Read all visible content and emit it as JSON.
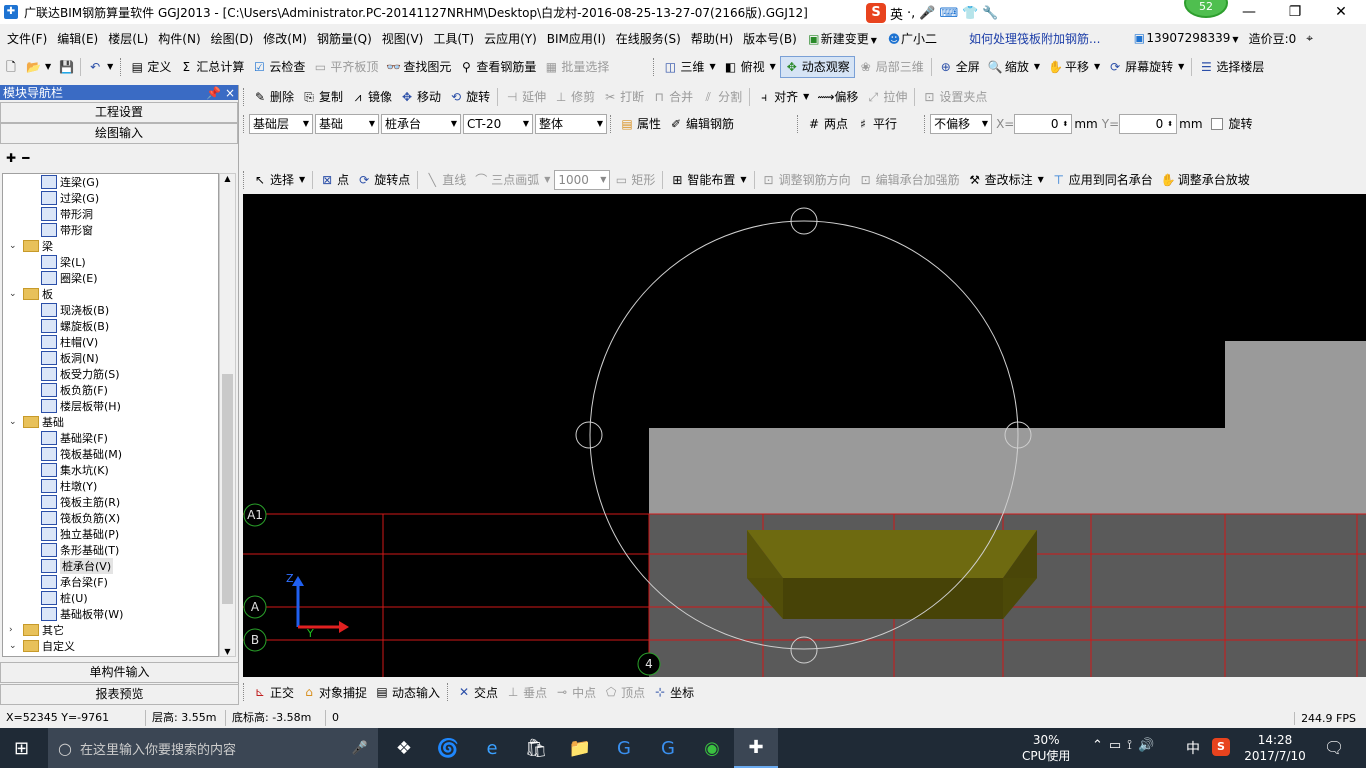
{
  "title": "广联达BIM钢筋算量软件 GGJ2013 - [C:\\Users\\Administrator.PC-20141127NRHM\\Desktop\\白龙村-2016-08-25-13-27-07(2166版).GGJ12]",
  "ime": {
    "mode": "英",
    "badge": "52"
  },
  "menu": [
    "文件(F)",
    "编辑(E)",
    "楼层(L)",
    "构件(N)",
    "绘图(D)",
    "修改(M)",
    "钢筋量(Q)",
    "视图(V)",
    "工具(T)",
    "云应用(Y)",
    "BIM应用(I)",
    "在线服务(S)",
    "帮助(H)",
    "版本号(B)",
    "新建变更",
    "广小二",
    "如何处理筏板附加钢筋...",
    "13907298339",
    "造价豆:0"
  ],
  "toolbar1": {
    "define": "定义",
    "sum": "汇总计算",
    "cloudcheck": "云检查",
    "flat": "平齐板顶",
    "find": "查找图元",
    "viewbar": "查看钢筋量",
    "batch": "批量选择",
    "three": "三维",
    "top": "俯视",
    "dynamic": "动态观察",
    "local3d": "局部三维",
    "full": "全屏",
    "zoom": "缩放",
    "pan": "平移",
    "rotate": "屏幕旋转",
    "floor": "选择楼层"
  },
  "toolbar2": {
    "delete": "删除",
    "copy": "复制",
    "mirror": "镜像",
    "move": "移动",
    "rotate": "旋转",
    "extend": "延伸",
    "trim": "修剪",
    "break": "打断",
    "merge": "合并",
    "split": "分割",
    "align": "对齐",
    "offset": "偏移",
    "stretch": "拉伸",
    "grip": "设置夹点"
  },
  "toolbar3": {
    "layer": "基础层",
    "cat": "基础",
    "type": "桩承台",
    "name": "CT-20",
    "whole": "整体",
    "prop": "属性",
    "editbar": "编辑钢筋",
    "twopt": "两点",
    "parallel": "平行",
    "offset": "不偏移",
    "xlabel": "X=",
    "xval": "0",
    "ylabel": "Y=",
    "yval": "0",
    "unit": "mm",
    "rot": "旋转"
  },
  "toolbar4": {
    "select": "选择",
    "point": "点",
    "rotpt": "旋转点",
    "line": "直线",
    "arc": "三点画弧",
    "len": "1000",
    "rect": "矩形",
    "smart": "智能布置",
    "adjdir": "调整钢筋方向",
    "editcap": "编辑承台加强筋",
    "label": "查改标注",
    "apply": "应用到同名承台",
    "slope": "调整承台放坡"
  },
  "sidebar": {
    "header": "模块导航栏",
    "btn1": "工程设置",
    "btn2": "绘图输入",
    "btn3": "单构件输入",
    "btn4": "报表预览",
    "tree": [
      {
        "t": "连梁(G)",
        "lvl": 2
      },
      {
        "t": "过梁(G)",
        "lvl": 2
      },
      {
        "t": "带形洞",
        "lvl": 2
      },
      {
        "t": "带形窗",
        "lvl": 2
      },
      {
        "t": "梁",
        "lvl": 1
      },
      {
        "t": "梁(L)",
        "lvl": 2
      },
      {
        "t": "圈梁(E)",
        "lvl": 2
      },
      {
        "t": "板",
        "lvl": 1
      },
      {
        "t": "现浇板(B)",
        "lvl": 2
      },
      {
        "t": "螺旋板(B)",
        "lvl": 2
      },
      {
        "t": "柱帽(V)",
        "lvl": 2
      },
      {
        "t": "板洞(N)",
        "lvl": 2
      },
      {
        "t": "板受力筋(S)",
        "lvl": 2
      },
      {
        "t": "板负筋(F)",
        "lvl": 2
      },
      {
        "t": "楼层板带(H)",
        "lvl": 2
      },
      {
        "t": "基础",
        "lvl": 1
      },
      {
        "t": "基础梁(F)",
        "lvl": 2
      },
      {
        "t": "筏板基础(M)",
        "lvl": 2
      },
      {
        "t": "集水坑(K)",
        "lvl": 2
      },
      {
        "t": "柱墩(Y)",
        "lvl": 2
      },
      {
        "t": "筏板主筋(R)",
        "lvl": 2
      },
      {
        "t": "筏板负筋(X)",
        "lvl": 2
      },
      {
        "t": "独立基础(P)",
        "lvl": 2
      },
      {
        "t": "条形基础(T)",
        "lvl": 2
      },
      {
        "t": "桩承台(V)",
        "lvl": 2,
        "sel": true
      },
      {
        "t": "承台梁(F)",
        "lvl": 2
      },
      {
        "t": "桩(U)",
        "lvl": 2
      },
      {
        "t": "基础板带(W)",
        "lvl": 2
      },
      {
        "t": "其它",
        "lvl": 1,
        "collapsed": true
      },
      {
        "t": "自定义",
        "lvl": 1
      }
    ]
  },
  "canvas": {
    "axes": [
      "A1",
      "A",
      "B",
      "4"
    ],
    "axisz": "Z",
    "axisy": "Y"
  },
  "snapbar": {
    "ortho": "正交",
    "snap": "对象捕捉",
    "dynin": "动态输入",
    "inter": "交点",
    "perp": "垂点",
    "mid": "中点",
    "vert": "顶点",
    "coord": "坐标"
  },
  "status": {
    "xy": "X=52345 Y=-9761",
    "floor": "层高: 3.55m",
    "bottom": "底标高: -3.58m",
    "zero": "0",
    "fps": "244.9 FPS"
  },
  "taskbar": {
    "search": "在这里输入你要搜索的内容",
    "cpu": "30%",
    "cpulabel": "CPU使用",
    "lang": "中",
    "time": "14:28",
    "date": "2017/7/10"
  }
}
